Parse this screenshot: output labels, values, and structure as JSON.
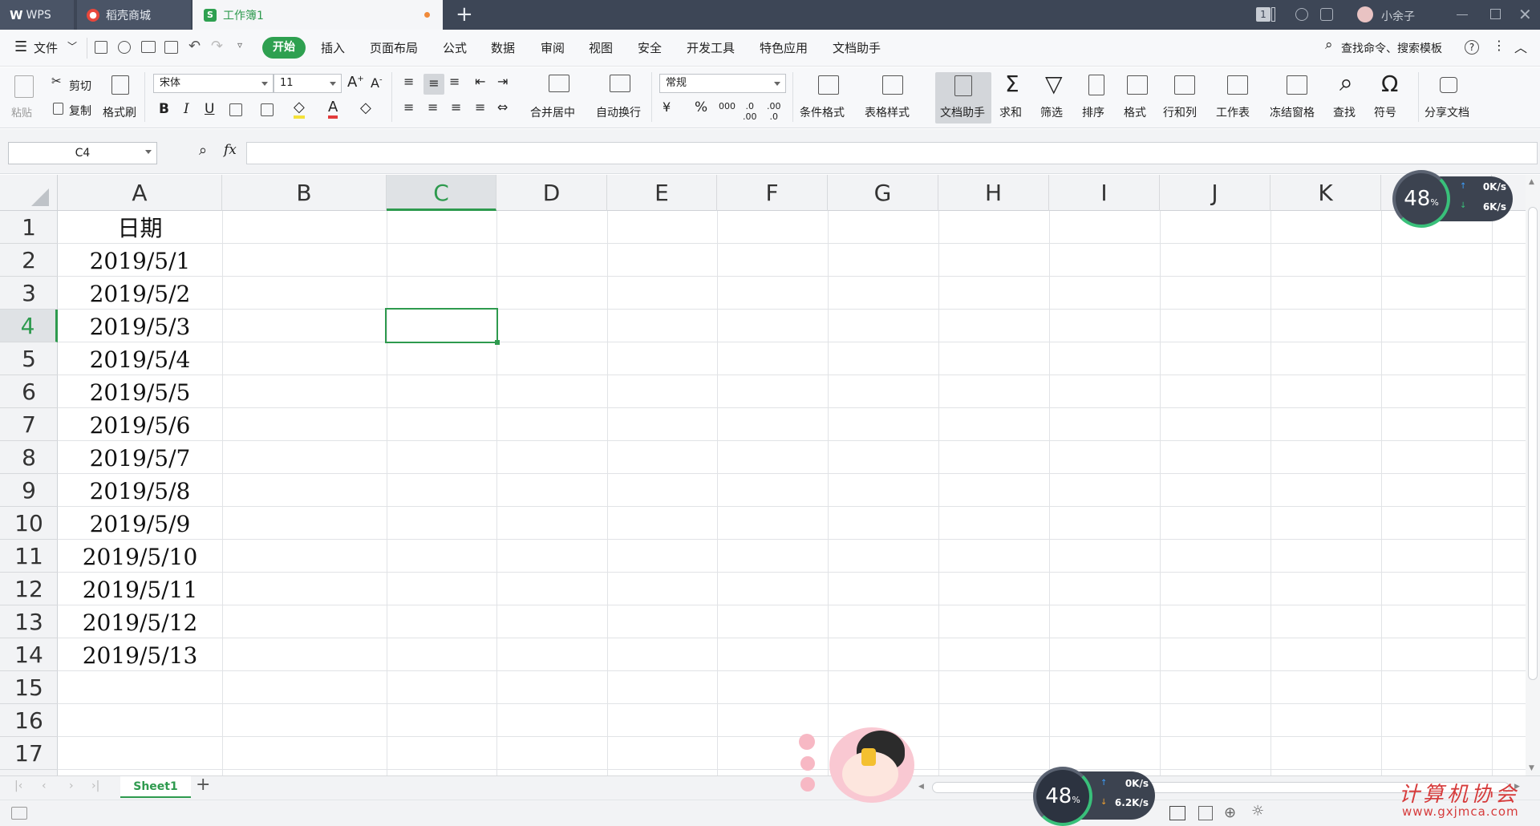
{
  "titlebar": {
    "tabs": [
      {
        "label": "WPS"
      },
      {
        "label": "稻壳商城"
      },
      {
        "label": "工作簿1"
      }
    ],
    "new_tab": "+",
    "badge": "1",
    "user": "小余子"
  },
  "menu": {
    "file": "文件",
    "items": [
      "开始",
      "插入",
      "页面布局",
      "公式",
      "数据",
      "审阅",
      "视图",
      "安全",
      "开发工具",
      "特色应用",
      "文档助手"
    ],
    "search": "查找命令、搜索模板"
  },
  "ribbon": {
    "paste": "粘贴",
    "cut": "剪切",
    "copy": "复制",
    "format_painter": "格式刷",
    "font_name": "宋体",
    "font_size": "11",
    "merge": "合并居中",
    "wrap": "自动换行",
    "number_format": "常规",
    "cond_format": "条件格式",
    "table_style": "表格样式",
    "doc_helper": "文档助手",
    "sum": "求和",
    "filter": "筛选",
    "sort": "排序",
    "format": "格式",
    "row_col": "行和列",
    "worksheet": "工作表",
    "freeze": "冻结窗格",
    "find": "查找",
    "symbol": "符号",
    "share": "分享文档"
  },
  "formula": {
    "name_box": "C4",
    "fx": "fx",
    "value": ""
  },
  "grid": {
    "columns": [
      "A",
      "B",
      "C",
      "D",
      "E",
      "F",
      "G",
      "H",
      "I",
      "J",
      "K"
    ],
    "rows": [
      "1",
      "2",
      "3",
      "4",
      "5",
      "6",
      "7",
      "8",
      "9",
      "10",
      "11",
      "12",
      "13",
      "14",
      "15",
      "16",
      "17"
    ],
    "col_a_values": [
      "日期",
      "2019/5/1",
      "2019/5/2",
      "2019/5/3",
      "2019/5/4",
      "2019/5/5",
      "2019/5/6",
      "2019/5/7",
      "2019/5/8",
      "2019/5/9",
      "2019/5/10",
      "2019/5/11",
      "2019/5/12",
      "2019/5/13"
    ],
    "selected_cell": "C4"
  },
  "sheets": {
    "active": "Sheet1",
    "add": "+"
  },
  "network_widget_top": {
    "cpu": "48",
    "unit": "%",
    "up": "0K/s",
    "down": "6K/s"
  },
  "network_widget_bottom": {
    "cpu": "48",
    "unit": "%",
    "up": "0K/s",
    "down": "6.2K/s"
  },
  "watermark": "计算机协会",
  "watermark_url": "www.gxjmca.com",
  "colors": {
    "accent": "#2ea050",
    "titlebar": "#3d4656"
  }
}
